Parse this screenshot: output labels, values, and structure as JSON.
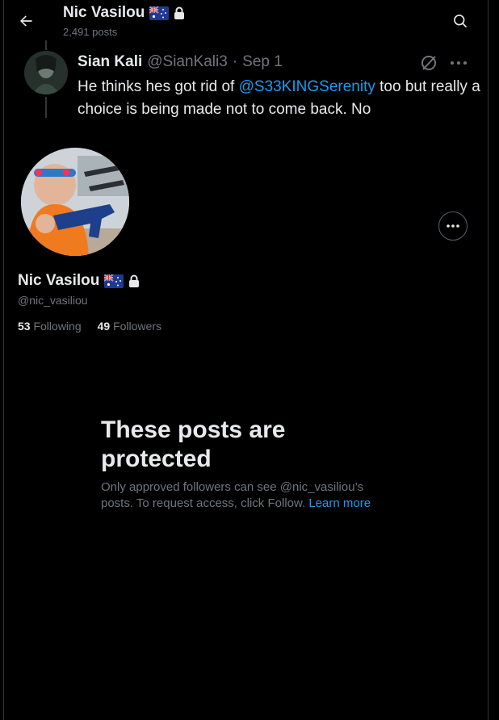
{
  "header": {
    "name": "Nic Vasilou",
    "post_count": "2,491 posts"
  },
  "quoted_tweet": {
    "author_name": "Sian Kali",
    "author_handle": "@SianKali3",
    "separator": "·",
    "date": "Sep 1",
    "text_before": "He thinks hes got rid of ",
    "mention": "@S33KINGSerenity",
    "text_after": " too but really a choice is being made not to come back. No"
  },
  "profile": {
    "name": "Nic Vasilou",
    "handle": "@nic_vasiliou",
    "following_count": "53",
    "following_label": "Following",
    "followers_count": "49",
    "followers_label": "Followers"
  },
  "protected": {
    "title": "These posts are protected",
    "description": "Only approved followers can see @nic_vasiliou’s posts. To request access, click Follow.",
    "learn_more": "Learn more"
  },
  "colors": {
    "background": "#000000",
    "text": "#e7e9ea",
    "secondary": "#71767b",
    "accent": "#1d9bf0"
  },
  "icons": {
    "back": "arrow-left-icon",
    "search": "search-icon",
    "flag": "australia-flag-icon",
    "lock": "lock-icon",
    "grok": "grok-icon",
    "more": "more-horizontal-icon"
  }
}
